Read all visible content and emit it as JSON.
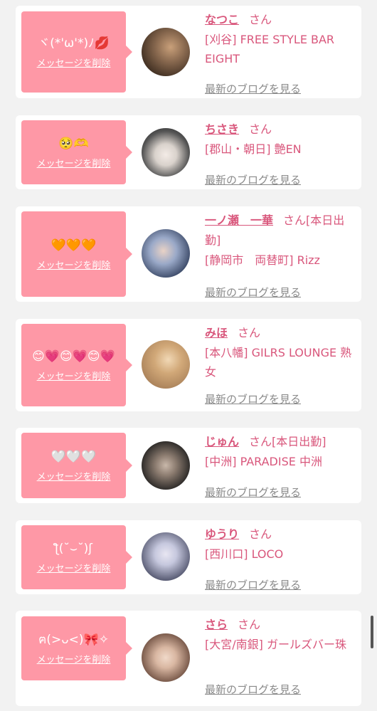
{
  "delete_label": "メッセージを削除",
  "blog_label": "最新のブログを見る",
  "san_label": "さん",
  "colors": {
    "bubble": "#fe98a6",
    "name": "#d9577c",
    "background": "#f2f2f2"
  },
  "cards": [
    {
      "message": "ヾ(*'ω'*)ﾉ💋",
      "name": "なつこ",
      "suffix": "",
      "shop": "[刈谷] FREE STYLE BAR EIGHT",
      "avatar_colors": [
        "#3a2a1e",
        "#c9a07a"
      ]
    },
    {
      "message": "🥺🫶",
      "name": "ちさき",
      "suffix": "",
      "shop": "[郡山・朝日] 艶EN",
      "avatar_colors": [
        "#2a2a2a",
        "#d9d2cc"
      ]
    },
    {
      "message": "🧡🧡🧡",
      "name": "一ノ瀬　一華",
      "suffix": "[本日出勤]",
      "shop": "[静岡市　両替町] Rizz",
      "avatar_colors": [
        "#23314f",
        "#9aa9c8"
      ]
    },
    {
      "message": "😊💗😊💗😊💗",
      "name": "みほ",
      "suffix": "",
      "shop": "[本八幡] GILRS LOUNGE 熟女",
      "avatar_colors": [
        "#a27a54",
        "#f1d8b5"
      ]
    },
    {
      "message": "🤍🤍🤍",
      "name": "じゅん",
      "suffix": "[本日出勤]",
      "shop": "[中洲] PARADISE 中洲",
      "avatar_colors": [
        "#1b1b1b",
        "#8c7c70"
      ]
    },
    {
      "message": "ƪ(˘⌣˘)ʃ",
      "name": "ゆうり",
      "suffix": "",
      "shop": "[西川口] LOCO",
      "avatar_colors": [
        "#3b3e57",
        "#c6c8de"
      ]
    },
    {
      "message": "ฅ(>ᴗ<)🎀✧",
      "name": "さら",
      "suffix": "",
      "shop": "[大宮/南銀] ガールズバー珠",
      "avatar_colors": [
        "#5a3b2e",
        "#d9b7a2"
      ]
    }
  ]
}
